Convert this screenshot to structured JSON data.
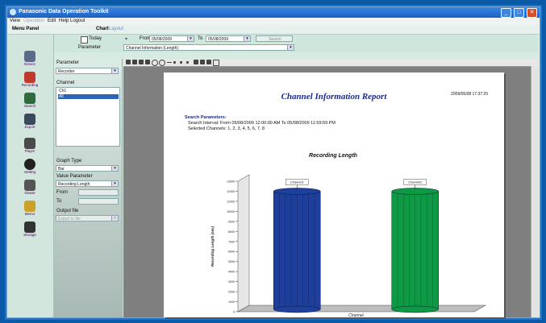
{
  "window": {
    "title": "Panasonic Data Operation Toolkit",
    "controls": [
      "_",
      "□",
      "✕"
    ]
  },
  "menubar": {
    "items": [
      {
        "label": "View",
        "disabled": false
      },
      {
        "label": "Operation",
        "disabled": true
      },
      {
        "label": "Edit",
        "disabled": false
      },
      {
        "label": "Help",
        "disabled": false
      },
      {
        "label": "Logout",
        "disabled": false
      }
    ]
  },
  "tabs": [
    {
      "label": "Menu Panel",
      "active": true
    },
    {
      "label": "Chart",
      "active": true
    },
    {
      "label": "Layout",
      "active": false
    }
  ],
  "filter": {
    "period_icon": "calendar-icon",
    "period_value": "Today",
    "from_label": "From",
    "from_value": "05/08/2009",
    "to_label": "To",
    "to_value": "05/08/2009",
    "search_button": "Search",
    "parameter_label": "Parameter",
    "parameter_value": "Channel Information (Length)"
  },
  "sidebar": {
    "items": [
      {
        "label": "Device",
        "icon": "device-icon",
        "color": "#5a6a8a"
      },
      {
        "label": "Recording",
        "icon": "recording-icon",
        "color": "#c0392b"
      },
      {
        "label": "Search",
        "icon": "search-icon",
        "color": "#2d6b3c"
      },
      {
        "label": "Export",
        "icon": "export-icon",
        "color": "#3a4a5a"
      },
      {
        "label": "Player",
        "icon": "player-icon",
        "color": "#4a4a4a"
      },
      {
        "label": "Setting",
        "icon": "setting-icon",
        "color": "#222"
      },
      {
        "label": "Viewer",
        "icon": "viewer-icon",
        "color": "#555"
      },
      {
        "label": "Memo",
        "icon": "memo-icon",
        "color": "#c9a227"
      },
      {
        "label": "Storage",
        "icon": "storage-icon",
        "color": "#333"
      }
    ]
  },
  "left_panel": {
    "parameter_label": "Parameter",
    "parameter_value": "Recorder",
    "channel_label": "Channel",
    "channel_items": [
      "Ch1",
      "All"
    ],
    "graph_type_label": "Graph Type",
    "graph_type_value": "Bar",
    "value_parameter_label": "Value Parameter",
    "value_parameter_value": "Recording Length",
    "from_label": "From",
    "to_label": "To",
    "output_label": "Output file",
    "output_value": "Export to file"
  },
  "report": {
    "title": "Channel Information Report",
    "date": "2009/05/08 17:37:25",
    "search_heading": "Search Parameters:",
    "search_interval": "Search Interval: From 05/08/2009 12:00:00 AM To 05/08/2009 11:59:59 PM",
    "selected_channels": "Selected Channels: 1, 2, 3, 4, 5, 6, 7, 8",
    "chart_title": "Recording Length"
  },
  "chart_data": {
    "type": "bar",
    "title": "Recording Length",
    "xlabel": "Channel",
    "ylabel": "Recording Length (sec)",
    "categories": [
      "Channel1",
      "Channel2"
    ],
    "series": [
      {
        "values": [
          12000,
          12000
        ],
        "colors": [
          "#1e3f9c",
          "#0e9a45"
        ]
      }
    ],
    "ylim": [
      0,
      13000
    ],
    "yticks": [
      "0",
      "1000",
      "2000",
      "3000",
      "4000",
      "5000",
      "6000",
      "7000",
      "8000",
      "9000",
      "10000",
      "11000",
      "12000",
      "13000"
    ],
    "grid": false,
    "style": "3d-cylinder"
  }
}
